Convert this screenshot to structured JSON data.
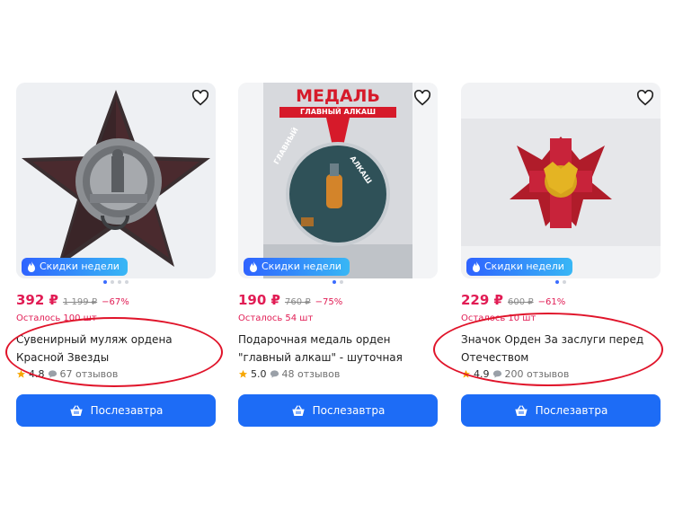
{
  "products": [
    {
      "price": "392 ₽",
      "old_price": "1 199 ₽",
      "discount": "−67%",
      "stock": "Осталось 100 шт",
      "title": "Сувенирный муляж ордена Красной Звезды",
      "rating": "4.8",
      "reviews": "67 отзывов",
      "badge": "Скидки недели",
      "button": "Послезавтра"
    },
    {
      "price": "190 ₽",
      "old_price": "760 ₽",
      "discount": "−75%",
      "stock": "Осталось 54 шт",
      "title": "Подарочная медаль орден \"главный алкаш\" - шуточная",
      "rating": "5.0",
      "reviews": "48 отзывов",
      "badge": "Скидки недели",
      "button": "Послезавтра",
      "image_text": {
        "banner_title": "МЕДАЛЬ",
        "banner_subtitle": "ГЛАВНЫЙ АЛКАШ",
        "medal_left": "ГЛАВНЫЙ",
        "medal_right": "АЛКАШ"
      }
    },
    {
      "price": "229 ₽",
      "old_price": "600 ₽",
      "discount": "−61%",
      "stock": "Осталось 10 шт",
      "title": "Значок Орден За заслуги перед Отечеством",
      "rating": "4.9",
      "reviews": "200 отзывов",
      "badge": "Скидки недели",
      "button": "Послезавтра"
    }
  ],
  "colors": {
    "price": "#e11c54",
    "button": "#1d6cf6",
    "annotation_circle": "#e0142a"
  },
  "icons": [
    "heart-icon",
    "fire-icon",
    "basket-icon",
    "star-icon",
    "comment-icon"
  ]
}
